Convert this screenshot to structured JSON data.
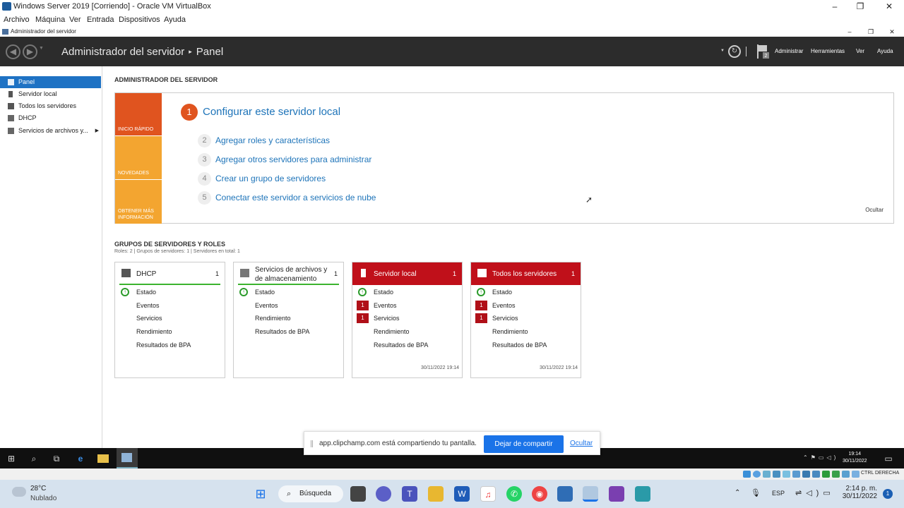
{
  "host_window": {
    "title": "Windows Server 2019 [Corriendo] - Oracle VM VirtualBox",
    "controls": [
      "–",
      "❐",
      "✕"
    ],
    "menu": [
      "Archivo",
      "Máquina",
      "Ver",
      "Entrada",
      "Dispositivos",
      "Ayuda"
    ]
  },
  "guest_window": {
    "title": "Administrador del servidor",
    "controls": [
      "–",
      "❐",
      "✕"
    ]
  },
  "header": {
    "app": "Administrador del servidor",
    "page": "Panel",
    "notification_count": "2",
    "menu": [
      "Administrar",
      "Herramientas",
      "Ver",
      "Ayuda"
    ]
  },
  "sidebar": {
    "items": [
      {
        "label": "Panel",
        "icon": "dashboard-icon",
        "selected": true
      },
      {
        "label": "Servidor local",
        "icon": "server-icon"
      },
      {
        "label": "Todos los servidores",
        "icon": "servers-icon"
      },
      {
        "label": "DHCP",
        "icon": "dhcp-icon"
      },
      {
        "label": "Servicios de archivos y...",
        "icon": "file-services-icon"
      }
    ]
  },
  "welcome": {
    "section_title": "ADMINISTRADOR DEL SERVIDOR",
    "tabs": [
      "INICIO RÁPIDO",
      "NOVEDADES",
      "OBTENER MÁS INFORMACIÓN"
    ],
    "step1_num": "1",
    "step1": "Configurar este servidor local",
    "steps": [
      {
        "num": "2",
        "label": "Agregar roles y características"
      },
      {
        "num": "3",
        "label": "Agregar otros servidores para administrar"
      },
      {
        "num": "4",
        "label": "Crear un grupo de servidores"
      },
      {
        "num": "5",
        "label": "Conectar este servidor a servicios de nube"
      }
    ],
    "hide": "Ocultar"
  },
  "groups": {
    "title": "GRUPOS DE SERVIDORES Y ROLES",
    "summary": "Roles: 2   |   Grupos de servidores: 1   |   Servidores en total: 1",
    "tiles": [
      {
        "name": "DHCP",
        "count": "1",
        "alert": false,
        "rows": [
          {
            "label": "Estado",
            "mark": "ok"
          },
          {
            "label": "Eventos"
          },
          {
            "label": "Servicios"
          },
          {
            "label": "Rendimiento"
          },
          {
            "label": "Resultados de BPA"
          }
        ],
        "timestamp": ""
      },
      {
        "name": "Servicios de archivos y de almacenamiento",
        "count": "1",
        "alert": false,
        "rows": [
          {
            "label": "Estado",
            "mark": "ok"
          },
          {
            "label": "Eventos"
          },
          {
            "label": "Rendimiento"
          },
          {
            "label": "Resultados de BPA"
          }
        ],
        "timestamp": ""
      },
      {
        "name": "Servidor local",
        "count": "1",
        "alert": true,
        "rows": [
          {
            "label": "Estado",
            "mark": "ok"
          },
          {
            "label": "Eventos",
            "badge": "1"
          },
          {
            "label": "Servicios",
            "badge": "1"
          },
          {
            "label": "Rendimiento"
          },
          {
            "label": "Resultados de BPA"
          }
        ],
        "timestamp": "30/11/2022 19:14"
      },
      {
        "name": "Todos los servidores",
        "count": "1",
        "alert": true,
        "rows": [
          {
            "label": "Estado",
            "mark": "ok"
          },
          {
            "label": "Eventos",
            "badge": "1"
          },
          {
            "label": "Servicios",
            "badge": "1"
          },
          {
            "label": "Rendimiento"
          },
          {
            "label": "Resultados de BPA"
          }
        ],
        "timestamp": "30/11/2022 19:14"
      }
    ]
  },
  "share_bar": {
    "message": "app.clipchamp.com está compartiendo tu pantalla.",
    "stop": "Dejar de compartir",
    "hide": "Ocultar"
  },
  "guest_taskbar": {
    "time": "19:14",
    "date": "30/11/2022"
  },
  "vbox_status": {
    "host_key": "CTRL DERECHA"
  },
  "host_taskbar": {
    "temperature": "28°C",
    "weather": "Nublado",
    "search": "Búsqueda",
    "language": "ESP",
    "time": "2:14 p. m.",
    "date": "30/11/2022",
    "notifications": "1"
  },
  "colors": {
    "header_bg": "#2c2c2c",
    "accent_blue": "#1e72c4",
    "quick_start": "#e0541f",
    "news": "#f3a530",
    "learn_more": "#f3a530",
    "alert_red": "#c0101a",
    "ok_green": "#2b9b2b"
  }
}
